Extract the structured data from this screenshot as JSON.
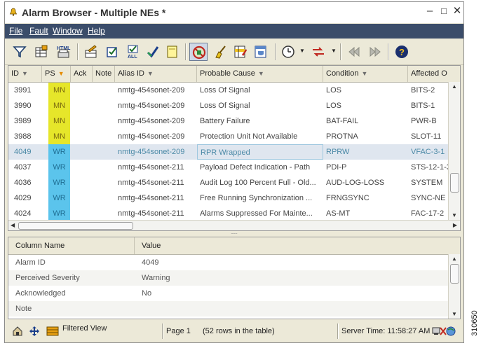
{
  "window": {
    "title": "Alarm Browser - Multiple NEs *"
  },
  "menu": {
    "file": "File",
    "fault": "Fault",
    "window": "Window",
    "help": "Help"
  },
  "toolbar": {
    "html_label": "HTML"
  },
  "table": {
    "columns": [
      "ID",
      "PS",
      "Ack",
      "Note",
      "Alias ID",
      "Probable Cause",
      "Condition",
      "Affected O"
    ],
    "rows": [
      {
        "id": "3991",
        "ps": "MN",
        "ack": "",
        "note": "",
        "alias": "nmtg-454sonet-209",
        "cause": "Loss Of Signal",
        "condition": "LOS",
        "affected": "BITS-2"
      },
      {
        "id": "3990",
        "ps": "MN",
        "ack": "",
        "note": "",
        "alias": "nmtg-454sonet-209",
        "cause": "Loss Of Signal",
        "condition": "LOS",
        "affected": "BITS-1"
      },
      {
        "id": "3989",
        "ps": "MN",
        "ack": "",
        "note": "",
        "alias": "nmtg-454sonet-209",
        "cause": "Battery Failure",
        "condition": "BAT-FAIL",
        "affected": "PWR-B"
      },
      {
        "id": "3988",
        "ps": "MN",
        "ack": "",
        "note": "",
        "alias": "nmtg-454sonet-209",
        "cause": "Protection Unit Not Available",
        "condition": "PROTNA",
        "affected": "SLOT-11"
      },
      {
        "id": "4049",
        "ps": "WR",
        "ack": "",
        "note": "",
        "alias": "nmtg-454sonet-209",
        "cause": "RPR Wrapped",
        "condition": "RPRW",
        "affected": "VFAC-3-1"
      },
      {
        "id": "4037",
        "ps": "WR",
        "ack": "",
        "note": "",
        "alias": "nmtg-454sonet-211",
        "cause": "Payload Defect Indication - Path",
        "condition": "PDI-P",
        "affected": "STS-12-1-3"
      },
      {
        "id": "4036",
        "ps": "WR",
        "ack": "",
        "note": "",
        "alias": "nmtg-454sonet-211",
        "cause": "Audit Log 100 Percent Full - Old...",
        "condition": "AUD-LOG-LOSS",
        "affected": "SYSTEM"
      },
      {
        "id": "4029",
        "ps": "WR",
        "ack": "",
        "note": "",
        "alias": "nmtg-454sonet-211",
        "cause": "Free Running Synchronization ...",
        "condition": "FRNGSYNC",
        "affected": "SYNC-NE"
      },
      {
        "id": "4024",
        "ps": "WR",
        "ack": "",
        "note": "",
        "alias": "nmtg-454sonet-211",
        "cause": "Alarms Suppressed For Mainte...",
        "condition": "AS-MT",
        "affected": "FAC-17-2"
      }
    ],
    "selected_index": 4
  },
  "detail": {
    "columns": [
      "Column Name",
      "Value"
    ],
    "rows": [
      {
        "name": "Alarm ID",
        "value": "4049"
      },
      {
        "name": "Perceived Severity",
        "value": "Warning"
      },
      {
        "name": "Acknowledged",
        "value": "No"
      },
      {
        "name": "Note",
        "value": ""
      }
    ]
  },
  "status": {
    "filter": "Filtered View",
    "page": "Page 1",
    "rows": "(52  rows in the table)",
    "time": "Server Time: 11:58:27 AM"
  },
  "figure_id": "310650",
  "colors": {
    "mn": "#e6e62a",
    "wr": "#5bc4ec",
    "menubar": "#3b4d6a",
    "selected_row": "#dfe6ef"
  }
}
